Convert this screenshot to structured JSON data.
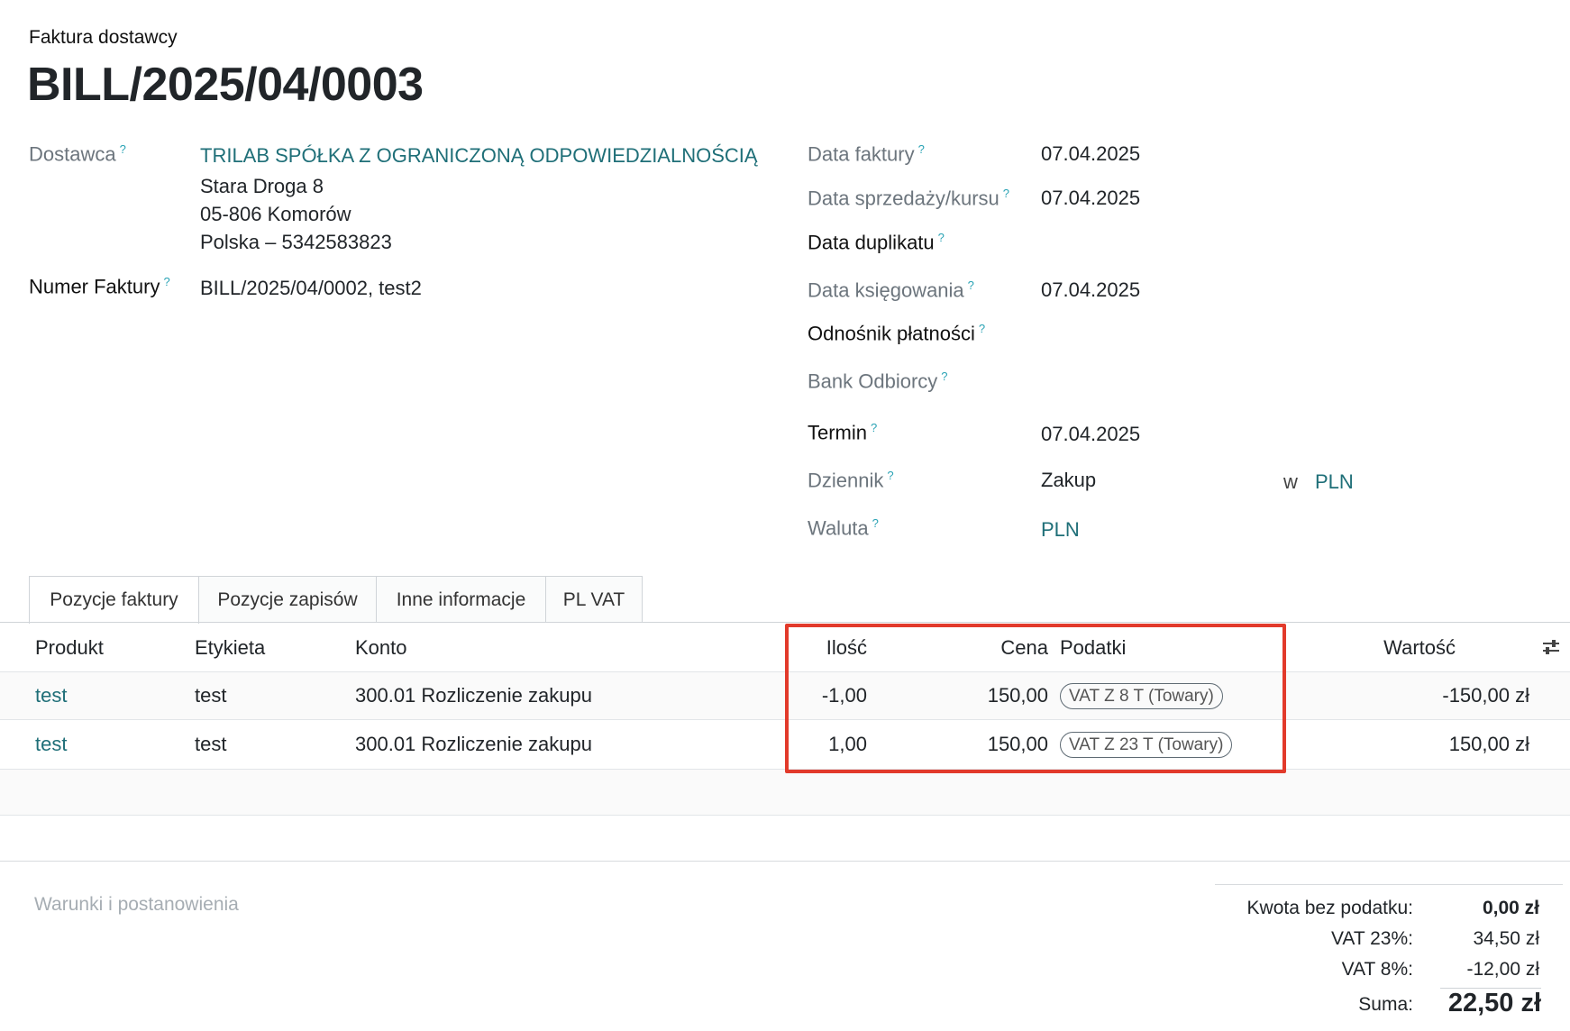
{
  "header": {
    "subtitle": "Faktura dostawcy",
    "title": "BILL/2025/04/0003"
  },
  "left_fields": {
    "vendor_label": "Dostawca",
    "vendor_name": "TRILAB SPÓŁKA Z OGRANICZONĄ ODPOWIEDZIALNOŚCIĄ",
    "vendor_address_1": "Stara Droga 8",
    "vendor_address_2": "05-806 Komorów",
    "vendor_address_3": "Polska – 5342583823",
    "invoice_number_label": "Numer Faktury",
    "invoice_number_value": "BILL/2025/04/0002, test2"
  },
  "right_fields": {
    "invoice_date_label": "Data faktury",
    "invoice_date_value": "07.04.2025",
    "sale_date_label": "Data sprzedaży/kursu",
    "sale_date_value": "07.04.2025",
    "duplicate_date_label": "Data duplikatu",
    "accounting_date_label": "Data księgowania",
    "accounting_date_value": "07.04.2025",
    "payment_ref_label": "Odnośnik płatności",
    "recipient_bank_label": "Bank Odbiorcy",
    "due_label": "Termin",
    "due_value": "07.04.2025",
    "journal_label": "Dziennik",
    "journal_value": "Zakup",
    "journal_in": "w",
    "journal_currency": "PLN",
    "currency_label": "Waluta",
    "currency_value": "PLN"
  },
  "tabs": [
    {
      "label": "Pozycje faktury"
    },
    {
      "label": "Pozycje zapisów"
    },
    {
      "label": "Inne informacje"
    },
    {
      "label": "PL VAT"
    }
  ],
  "table": {
    "headers": {
      "product": "Produkt",
      "label": "Etykieta",
      "account": "Konto",
      "quantity": "Ilość",
      "price": "Cena",
      "taxes": "Podatki",
      "value": "Wartość"
    },
    "rows": [
      {
        "product": "test",
        "label": "test",
        "account": "300.01 Rozliczenie zakupu",
        "quantity": "-1,00",
        "price": "150,00",
        "tax": "VAT Z 8 T (Towary)",
        "value": "-150,00 zł"
      },
      {
        "product": "test",
        "label": "test",
        "account": "300.01 Rozliczenie zakupu",
        "quantity": "1,00",
        "price": "150,00",
        "tax": "VAT Z 23 T (Towary)",
        "value": "150,00 zł"
      }
    ]
  },
  "footer": {
    "terms_placeholder": "Warunki i postanowienia",
    "untaxed_label": "Kwota bez podatku:",
    "untaxed_value": "0,00 zł",
    "vat23_label": "VAT 23%:",
    "vat23_value": "34,50 zł",
    "vat8_label": "VAT 8%:",
    "vat8_value": "-12,00 zł",
    "total_label": "Suma:",
    "total_value": "22,50 zł"
  },
  "colors": {
    "link": "#1f6f78",
    "help_marker": "#2aa3b5",
    "highlight_border": "#e23a2b"
  },
  "icons": {
    "column_settings": "sliders-icon",
    "help": "question-mark-icon"
  }
}
